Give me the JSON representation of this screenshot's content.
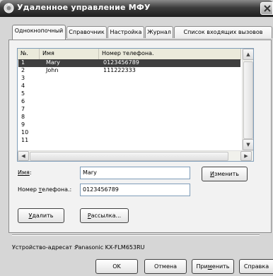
{
  "window": {
    "title": "Удаленное управление МФУ"
  },
  "tabs": [
    {
      "label": "Однокнопочный",
      "active": true
    },
    {
      "label": "Справочник",
      "active": false
    },
    {
      "label": "Настройка",
      "active": false
    },
    {
      "label": "Журнал",
      "active": false
    },
    {
      "label": "Список входящих вызовов",
      "active": false
    }
  ],
  "table": {
    "columns": [
      "№.",
      "Имя",
      "Номер телефона."
    ],
    "rows": [
      {
        "num": "1",
        "name": "Mary",
        "phone": "0123456789",
        "selected": true
      },
      {
        "num": "2",
        "name": "John",
        "phone": "111222333"
      },
      {
        "num": "3",
        "name": "",
        "phone": ""
      },
      {
        "num": "4",
        "name": "",
        "phone": ""
      },
      {
        "num": "5",
        "name": "",
        "phone": ""
      },
      {
        "num": "6",
        "name": "",
        "phone": ""
      },
      {
        "num": "7",
        "name": "",
        "phone": ""
      },
      {
        "num": "8",
        "name": "",
        "phone": ""
      },
      {
        "num": "9",
        "name": "",
        "phone": ""
      },
      {
        "num": "10",
        "name": "",
        "phone": ""
      },
      {
        "num": "11",
        "name": "",
        "phone": ""
      }
    ]
  },
  "form": {
    "name_label_text": "Имя",
    "name_label_accel": ":",
    "name_value": "Mary",
    "phone_label_prefix": "Номер ",
    "phone_label_accel": "т",
    "phone_label_rest": "елефона.:",
    "phone_value": "0123456789"
  },
  "buttons": {
    "change": {
      "accel": "И",
      "rest": "зменить"
    },
    "delete": {
      "accel": "У",
      "rest": "далить"
    },
    "broadcast": {
      "accel": "Р",
      "rest": "ассылка..."
    },
    "ok": "OK",
    "cancel": "Отмена",
    "apply": {
      "pre": "При",
      "accel": "м",
      "rest": "енить"
    },
    "help": "Справка"
  },
  "device": {
    "label": "Устройство-адресат :",
    "value": "Panasonic KX-FLM653RU"
  },
  "icons": [
    "app-icon",
    "close-icon",
    "scroll-up-icon",
    "scroll-down-icon",
    "scroll-left-icon",
    "scroll-right-icon"
  ]
}
